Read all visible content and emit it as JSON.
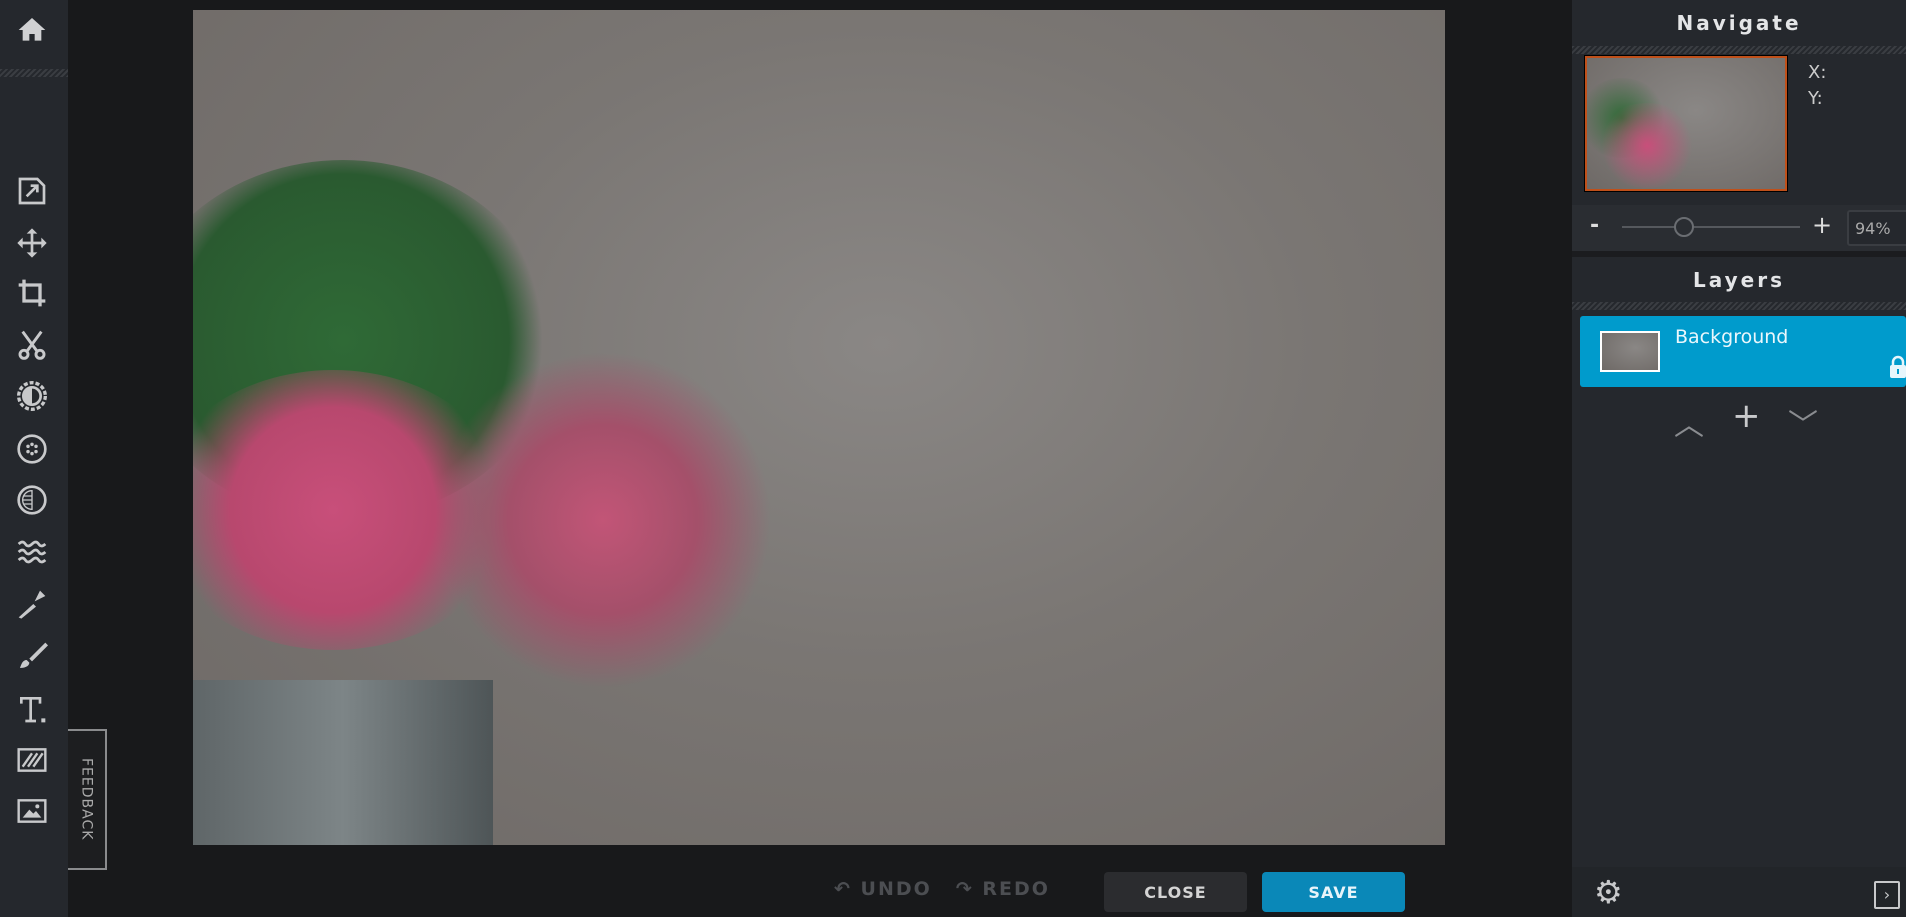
{
  "sidebar": {
    "tools": [
      "home",
      "export",
      "move",
      "crop",
      "cut",
      "adjust",
      "filter",
      "vignette",
      "liquify",
      "clone-stamp",
      "brush",
      "text",
      "pattern",
      "add-image"
    ]
  },
  "feedback_label": "FEEDBACK",
  "navigate": {
    "title": "Navigate",
    "x_label": "X:",
    "y_label": "Y:",
    "zoom_minus": "-",
    "zoom_plus": "+",
    "zoom_value": "94%",
    "zoom_fraction": 0.35
  },
  "layers": {
    "title": "Layers",
    "items": [
      {
        "name": "Background",
        "locked": true,
        "selected": true
      }
    ]
  },
  "bottom": {
    "undo": "UNDO",
    "redo": "REDO",
    "close": "CLOSE",
    "save": "SAVE"
  },
  "colors": {
    "accent": "#009bcc",
    "save": "#0a88b8",
    "nav_border": "#c0501a"
  }
}
